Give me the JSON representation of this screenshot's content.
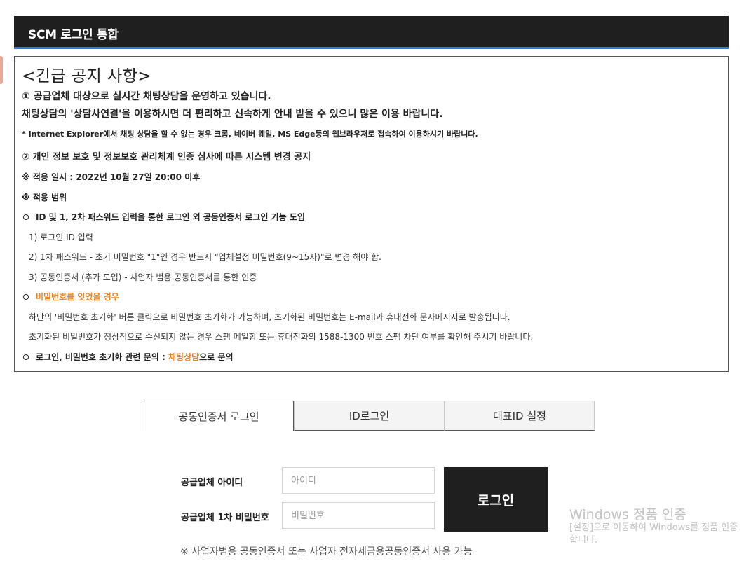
{
  "header": {
    "title": "SCM 로그인 통합"
  },
  "notice": {
    "title": "<긴급 공지 사항>",
    "item1_line1": "① 공급업체 대상으로 실시간 채팅상담을 운영하고 있습니다.",
    "item1_line2": "채팅상담의 '상담사연결'을 이용하시면 더 편리하고 신속하게 안내 받을 수 있으니 많은 이용 바랍니다.",
    "item1_note": "* Internet Explorer에서 채팅 상담을 할 수 없는 경우 크롬, 네이버 웨일, MS Edge등의 웹브라우저로 접속하여 이용하시기 바랍니다.",
    "item2_title": "② 개인 정보 보호 및 정보보호 관리체계 인증 심사에 따른 시스템 변경 공지",
    "apply_date": "※ 적용 일시 : 2022년 10월 27일 20:00 이후",
    "apply_scope": "※ 적용 범위",
    "scope_bullet": "ID 및 1, 2차 패스워드 입력을 통한 로그인 외 공동인증서 로그인 기능 도입",
    "scope_items": [
      "1) 로그인 ID 입력",
      "2) 1차 패스워드 - 초기 비밀번호 \"1\"인 경우 반드시 \"업체설정 비밀번호(9~15자)\"로 변경 해야 함.",
      "3) 공동인증서 (추가 도입) - 사업자 범용 공동인증서를 통한 인증"
    ],
    "forgot_title": "비밀번호를 잊었을 경우",
    "forgot_desc1": "하단의 '비밀번호 초기화' 버튼 클릭으로 비밀번호 초기화가 가능하며, 초기화된 비밀번호는 E-mail과 휴대전화 문자메시지로 발송됩니다.",
    "forgot_desc2": "초기화된 비밀번호가 정상적으로 수신되지 않는 경우 스팸 메일함 또는 휴대전화의 1588-1300 번호 스팸 차단 여부를 확인해 주시기 바랍니다.",
    "inquiry_prefix": "로그인, 비밀번호 초기화 관련 문의 : ",
    "inquiry_link": "채팅상담",
    "inquiry_suffix": "으로 문의"
  },
  "tabs": [
    {
      "label": "공동인증서 로그인",
      "active": true
    },
    {
      "label": "ID로그인",
      "active": false
    },
    {
      "label": "대표ID 설정",
      "active": false
    }
  ],
  "form": {
    "id_label": "공급업체 아이디",
    "id_placeholder": "아이디",
    "pw_label": "공급업체 1차 비밀번호",
    "pw_placeholder": "비밀번호",
    "login_button": "로그인",
    "cert_note": "※ 사업자범용 공동인증서 또는 사업자 전자세금용공동인증서 사용 가능"
  },
  "watermark": {
    "title": "Windows 정품 인증",
    "subtitle": "[설정]으로 이동하여 Windows를 정품 인증합니다."
  },
  "colors": {
    "header_bg": "#1f1f1f",
    "header_accent": "#2a7fd6",
    "highlight_orange": "#e6862a",
    "login_button_bg": "#1f1f1f"
  }
}
